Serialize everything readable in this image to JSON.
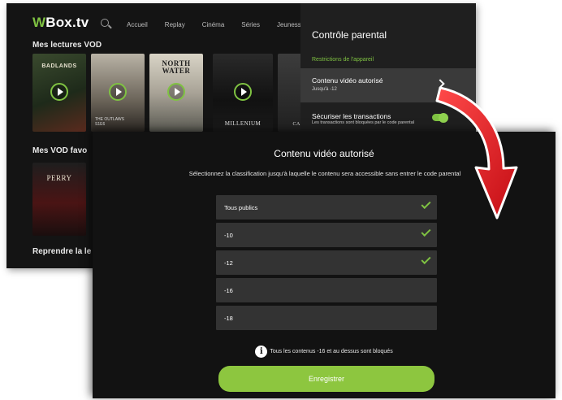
{
  "app": {
    "logo_prefix": "W",
    "logo_rest": "Box.tv",
    "nav": [
      "Accueil",
      "Replay",
      "Cinéma",
      "Séries",
      "Jeunesse"
    ],
    "sections": {
      "lectures": "Mes lectures VOD",
      "favoris": "Mes VOD favo",
      "reprendre": "Reprendre la le"
    },
    "posters": [
      {
        "title": "BADLANDS",
        "caption": ""
      },
      {
        "title": "",
        "caption": "THE OUTLAWS\nS1E6"
      },
      {
        "title": "NORTH\nWATER",
        "caption": ""
      },
      {
        "title": "MILLENIUM",
        "caption": ""
      },
      {
        "title": "CAPTAIN",
        "caption": ""
      }
    ],
    "favori_poster": "PERRY"
  },
  "panel": {
    "title": "Contrôle parental",
    "subheader": "Restrictions de l'appareil",
    "row1_label": "Contenu vidéo autorisé",
    "row1_value": "Jusqu'à -12",
    "row2_label": "Sécuriser les transactions",
    "row2_desc": "Les transactions sont bloquées par le code parental",
    "toggle_on": true
  },
  "dialog": {
    "title": "Contenu vidéo autorisé",
    "description": "Sélectionnez la classification jusqu'à laquelle le contenu sera accessible sans entrer le code parental",
    "options": [
      {
        "label": "Tous publics",
        "checked": true
      },
      {
        "label": "-10",
        "checked": true
      },
      {
        "label": "-12",
        "checked": true
      },
      {
        "label": "-16",
        "checked": false
      },
      {
        "label": "-18",
        "checked": false
      }
    ],
    "info_text": "Tous les contenus -16 et au dessus sont bloqués",
    "save_label": "Enregistrer"
  },
  "colors": {
    "accent": "#8dc63f",
    "arrow": "#e3151c",
    "background": "#121212"
  }
}
